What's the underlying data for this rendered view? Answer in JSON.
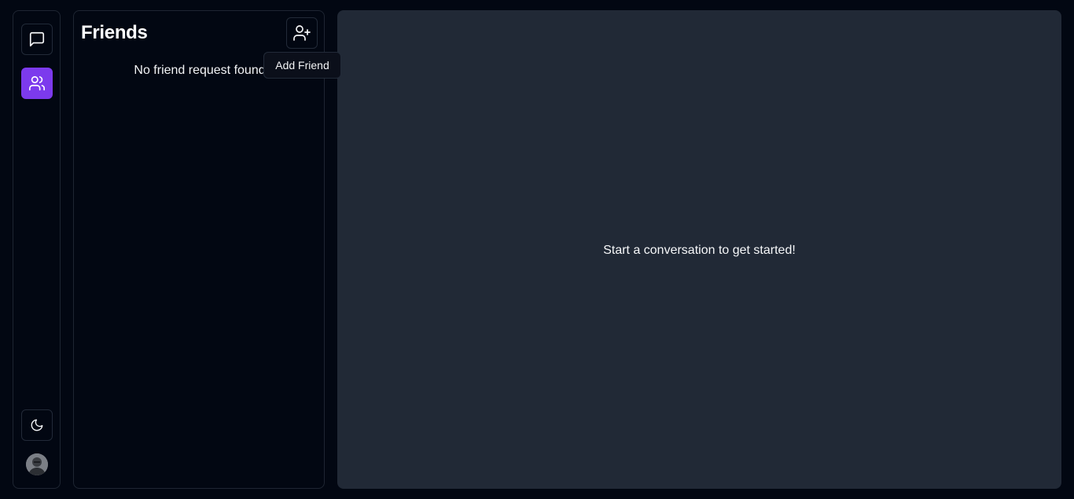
{
  "nav": {
    "items": [
      {
        "icon": "message-square-icon",
        "active": false
      },
      {
        "icon": "users-icon",
        "active": true
      }
    ],
    "theme_icon": "moon-icon",
    "accent_color": "#7c3aed"
  },
  "friends_panel": {
    "title": "Friends",
    "add_button_icon": "user-plus-icon",
    "empty_message": "No friend request found"
  },
  "tooltip": {
    "text": "Add Friend"
  },
  "main": {
    "placeholder": "Start a conversation to get started!",
    "background": "#212936"
  }
}
